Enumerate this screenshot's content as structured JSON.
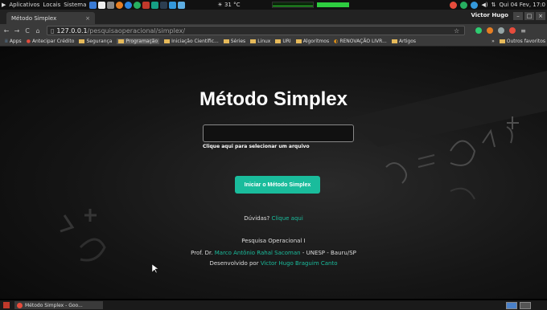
{
  "system_panel": {
    "menus": [
      "Aplicativos",
      "Locais",
      "Sistema"
    ],
    "weather": "31 °C",
    "clock": "Qui 04 Fev, 17:0"
  },
  "browser": {
    "tab_title": "Método Simplex",
    "tab_close": "×",
    "user": "Victor Hugo",
    "url_host": "127.0.0.1",
    "url_path": "/pesquisaoperacional/simplex/",
    "bookmarks": [
      "Apps",
      "Antecipar Crédito",
      "Segurança",
      "Programação",
      "Iniciação Científic...",
      "Séries",
      "Linux",
      "URI",
      "Algoritmos",
      "RENOVAÇÃO LIVR...",
      "Artigos"
    ],
    "bookmarks_overflow": "»",
    "other_bookmarks": "Outros favoritos"
  },
  "page": {
    "title": "Método Simplex",
    "file_hint": "Clique aqui para selecionar um arquivo",
    "start_button": "Iniciar o Método Simplex",
    "doubts_label": "Dúvidas?",
    "doubts_link": "Clique aqui",
    "course": "Pesquisa Operacional I",
    "prof_prefix": "Prof. Dr.",
    "prof_name": "Marco Antônio Rahal Sacoman",
    "prof_suffix": "- UNESP - Bauru/SP",
    "dev_prefix": "Desenvolvido por",
    "dev_name": "Victor Hugo Braguim Canto"
  },
  "taskbar": {
    "window_label": "Método Simplex - Goo..."
  },
  "colors": {
    "accent": "#1abc9c",
    "folder": "#e5b95a"
  }
}
